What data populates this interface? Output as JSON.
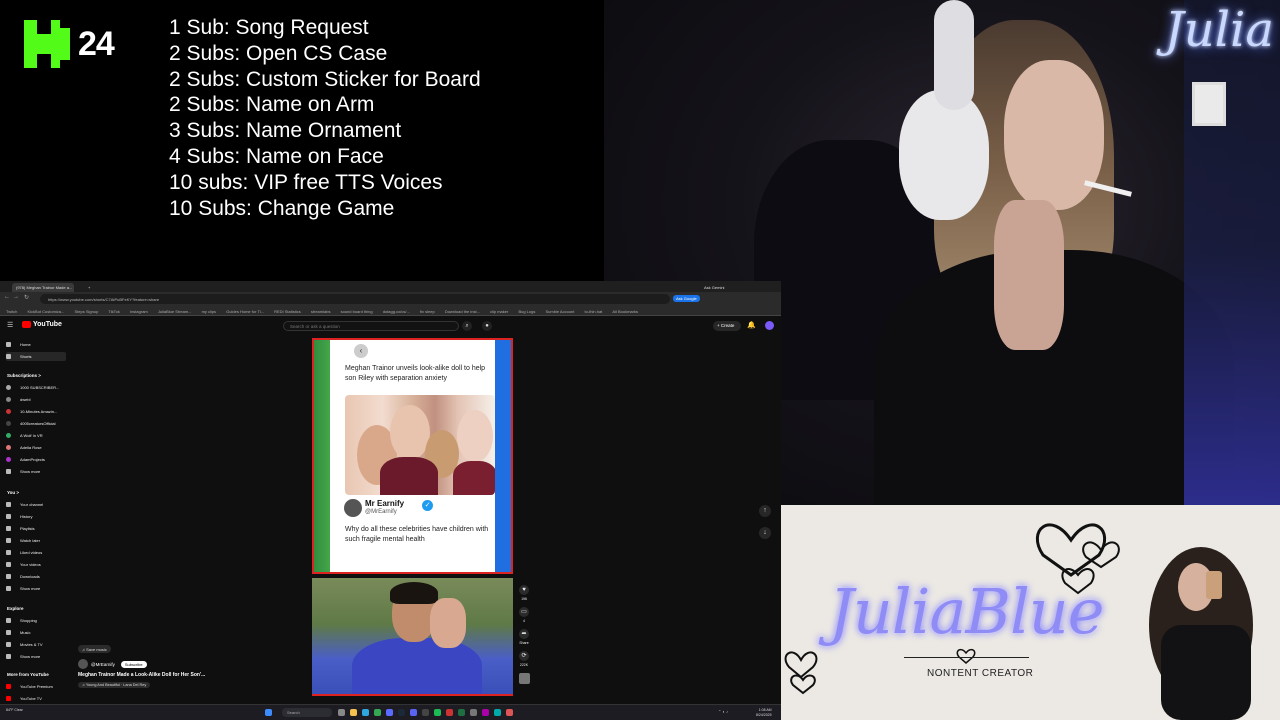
{
  "overlay": {
    "platform_logo": "kick-logo",
    "viewer_count": "24",
    "sub_goals": [
      "1 Sub: Song Request",
      "2 Subs: Open CS Case",
      "2 Subs: Custom Sticker for Board",
      "2 Subs: Name on Arm",
      "3 Subs: Name Ornament",
      "4 Subs: Name on Face",
      "10 subs: VIP free TTS Voices",
      "10 Subs: Change Game"
    ],
    "webcam_logo": "Julia",
    "banner": {
      "name": "JuliaBlue",
      "subtitle": "NONTENT CREATOR"
    }
  },
  "browser": {
    "tab_title": "(978) Meghan Trainor Made a...",
    "ask_gemini": "Ask Gemini",
    "url": "https://www.youtube.com/shorts/C7AtPuBFeKY?feature=share",
    "bookmarks": [
      "Twitch",
      "KickBot Customiza...",
      "Steps Signup",
      "TikTok",
      "Instagram",
      "JuliaBlue Stream...",
      "my clips",
      "Guides Home for Ti...",
      "REDI Statistics",
      "streamlabs",
      "sound board thing",
      "dotagg.co/cs/...",
      "fix sleep",
      "Download the inst...",
      "clip maker",
      "Bug Logs",
      "Sumble Account",
      "to-thin.hat",
      "All Bookmarks"
    ],
    "ask_google": "Ask Google"
  },
  "youtube": {
    "logo_text": "YouTube",
    "search_placeholder": "Search or ask a question",
    "create_label": "+ Create",
    "sidebar": {
      "home": "Home",
      "shorts": "Shorts",
      "subscriptions_heading": "Subscriptions >",
      "subscriptions": [
        "1000 SUBSCRIBER...",
        "dwebl",
        "10-Minutes Amazin...",
        "4005creatorsOfficial",
        "A Wolf In VR",
        "Adelia Rose",
        "AdamProjects"
      ],
      "show_more": "Show more",
      "you_heading": "You >",
      "you_items": [
        "Your channel",
        "History",
        "Playlists",
        "Watch later",
        "Liked videos",
        "Your videos",
        "Downloads"
      ],
      "show_more_2": "Show more",
      "explore_heading": "Explore",
      "explore_items": [
        "Shopping",
        "Music",
        "Movies & TV"
      ],
      "show_more_3": "Show more",
      "more_heading": "More from YouTube",
      "more_items": [
        "YouTube Premium",
        "YouTube TV"
      ]
    },
    "short": {
      "headline": "Meghan Trainor unveils look-alike doll to help son Riley with separation anxiety",
      "tweet_author": "Mr Earnify",
      "tweet_handle": "@MrEarnify",
      "tweet_body": "Why do all these celebrities have children with such fragile mental health",
      "save_music": "Save music",
      "channel": "@MrEarnify",
      "subscribe": "Subscribe",
      "title": "Meghan Trainor Made a Look-Alike Doll for Her Son'...",
      "song": "♫ Young And Beautiful · Lana Del Rey",
      "like_count": "196",
      "comment_count": "4",
      "share_label": "Share",
      "remix_count": "222K"
    }
  },
  "taskbar": {
    "search_placeholder": "Search",
    "weather": "84°F Clear",
    "time": "1:08 AM",
    "date": "8/24/2025"
  }
}
